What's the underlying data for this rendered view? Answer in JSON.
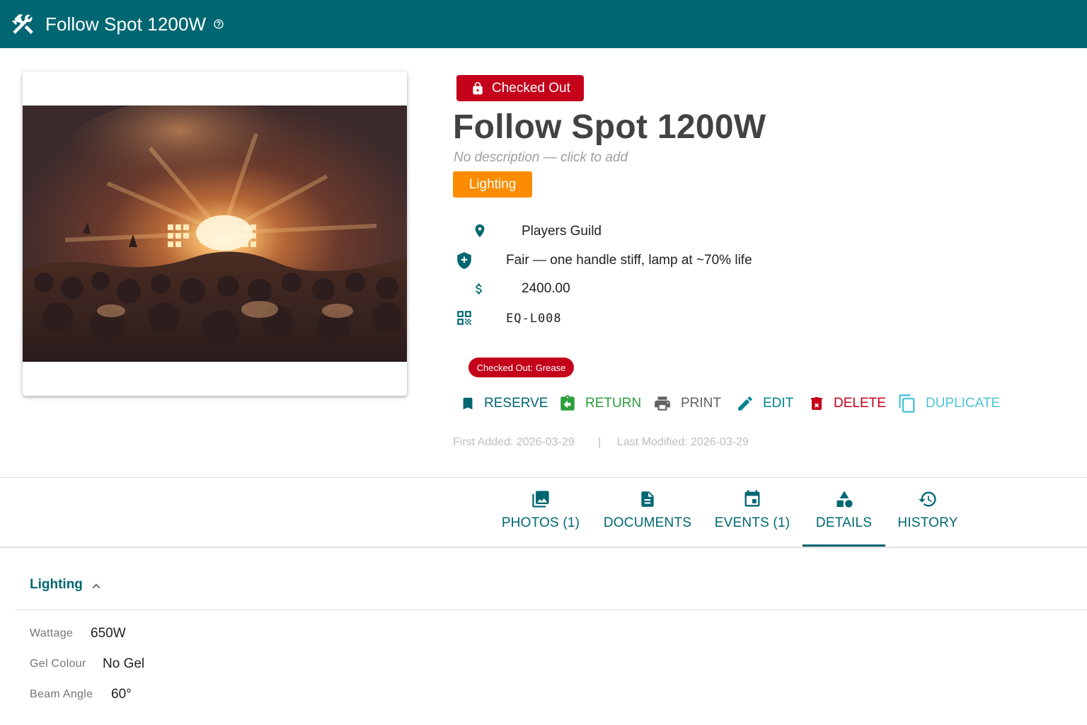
{
  "app_bar": {
    "title": "Follow Spot 1200W",
    "tools_icon": "tools-icon",
    "help_icon": "help-circle-icon",
    "color": "#006772"
  },
  "item": {
    "status": "Checked Out",
    "status_color": "#c4001a",
    "name": "Follow Spot 1200W",
    "description_placeholder": "No description — click to add",
    "category": "Lighting",
    "category_color": "#fb8c00",
    "location": "Players Guild",
    "condition": "Fair — one handle stiff, lamp at ~70% life",
    "price": "2400.00",
    "asset_id": "EQ-L008",
    "checkout_badge": "Checked Out: Grease"
  },
  "actions": [
    {
      "label": "RESERVE",
      "icon": "bookmark-icon",
      "color": "#006772"
    },
    {
      "label": "RETURN",
      "icon": "clipboard-return-icon",
      "color": "#2e9e3e"
    },
    {
      "label": "PRINT",
      "icon": "printer-icon",
      "color": "#616161"
    },
    {
      "label": "EDIT",
      "icon": "pencil-icon",
      "color": "#00838f"
    },
    {
      "label": "DELETE",
      "icon": "trash-icon",
      "color": "#c4001a"
    },
    {
      "label": "DUPLICATE",
      "icon": "copy-icon",
      "color": "#4dc3d6"
    }
  ],
  "meta": {
    "first_added": "First Added: 2026-03-29",
    "separator": "|",
    "last_modified": "Last Modified: 2026-03-29"
  },
  "tabs": [
    {
      "label": "PHOTOS (1)",
      "icon": "photos-icon"
    },
    {
      "label": "DOCUMENTS",
      "icon": "document-icon"
    },
    {
      "label": "EVENTS (1)",
      "icon": "calendar-icon"
    },
    {
      "label": "DETAILS",
      "icon": "shapes-icon",
      "active": true
    },
    {
      "label": "HISTORY",
      "icon": "history-icon"
    }
  ],
  "details": {
    "section_title": "Lighting",
    "fields": [
      {
        "label": "Wattage",
        "value": "650W"
      },
      {
        "label": "Gel Colour",
        "value": "No Gel"
      },
      {
        "label": "Beam Angle",
        "value": "60°"
      }
    ]
  }
}
